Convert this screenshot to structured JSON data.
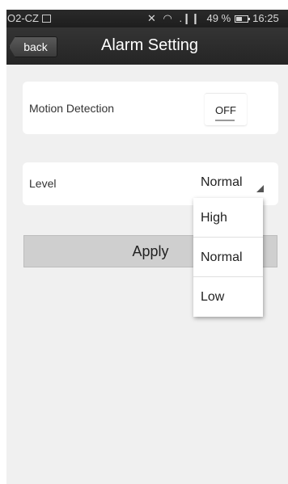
{
  "status_bar": {
    "carrier": "O2-CZ",
    "icons": [
      "mute-icon",
      "wifi-icon",
      "signal-icon"
    ],
    "battery": "49 %",
    "time": "16:25"
  },
  "header": {
    "back_label": "back",
    "title": "Alarm Setting"
  },
  "motion": {
    "label": "Motion Detection",
    "toggle_value": "OFF"
  },
  "level": {
    "label": "Level",
    "selected": "Normal",
    "options": [
      "High",
      "Normal",
      "Low"
    ]
  },
  "apply_label": "Apply",
  "colors": {
    "title_bar": "#2c2c2c",
    "background": "#f0f0f0",
    "apply_button": "#cfcfcf"
  }
}
